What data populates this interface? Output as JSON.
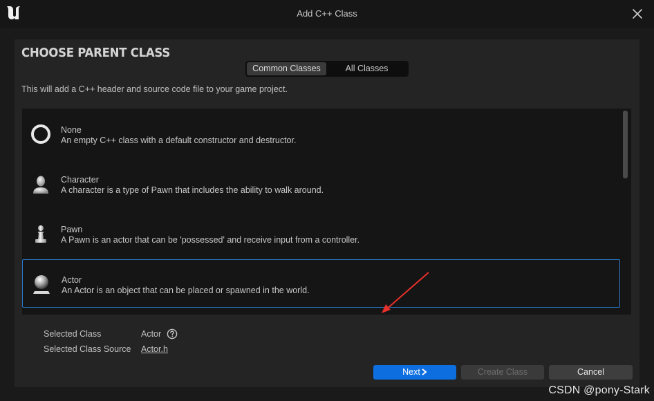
{
  "window": {
    "title": "Add C++ Class"
  },
  "header": {
    "heading": "CHOOSE PARENT CLASS",
    "tabs": [
      {
        "label": "Common Classes",
        "active": true
      },
      {
        "label": "All Classes",
        "active": false
      }
    ],
    "description": "This will add a C++ header and source code file to your game project."
  },
  "classes": [
    {
      "name": "None",
      "description": "An empty C++ class with a default constructor and destructor.",
      "icon": "ring-icon",
      "selected": false
    },
    {
      "name": "Character",
      "description": "A character is a type of Pawn that includes the ability to walk around.",
      "icon": "character-bust-icon",
      "selected": false
    },
    {
      "name": "Pawn",
      "description": "A Pawn is an actor that can be 'possessed' and receive input from a controller.",
      "icon": "chess-pawn-icon",
      "selected": false
    },
    {
      "name": "Actor",
      "description": "An Actor is an object that can be placed or spawned in the world.",
      "icon": "sphere-on-pedestal-icon",
      "selected": true
    }
  ],
  "selection": {
    "class_label": "Selected Class",
    "class_value": "Actor",
    "source_label": "Selected Class Source",
    "source_value": "Actor.h"
  },
  "buttons": {
    "next": "Next",
    "next_icon": "chevron-right-icon",
    "create": "Create Class",
    "cancel": "Cancel"
  },
  "watermark": "CSDN @pony-Stark",
  "colors": {
    "accent": "#0d6ee0",
    "selection_border": "#2a78c8",
    "annotation_arrow": "#e8302a"
  }
}
